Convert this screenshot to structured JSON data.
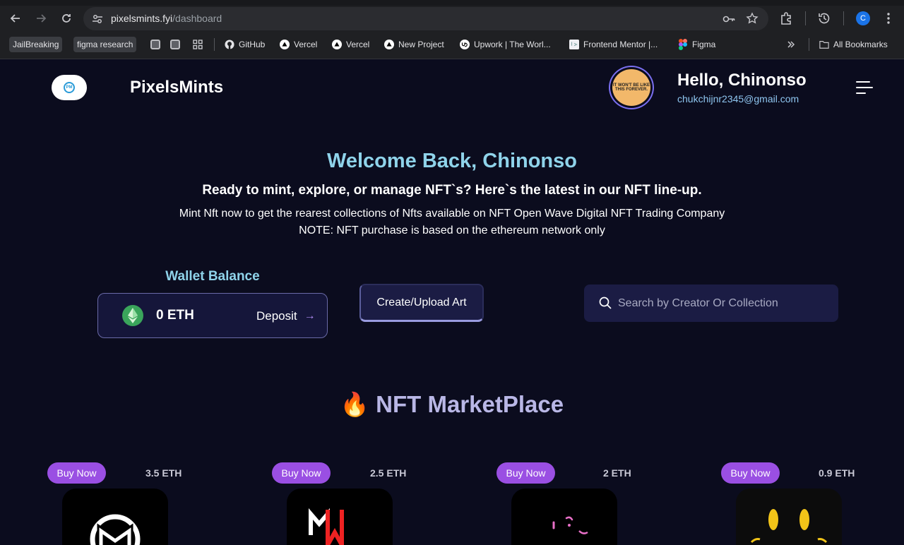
{
  "browser": {
    "url_domain": "pixelsmints.fyi",
    "url_path": "/dashboard",
    "profile_initial": "C",
    "bookmarks": [
      {
        "label": "JailBreaking",
        "kind": "chip"
      },
      {
        "label": "figma research",
        "kind": "chip"
      },
      {
        "label": "GitHub",
        "icon": "github-icon"
      },
      {
        "label": "Vercel",
        "icon": "vercel-icon"
      },
      {
        "label": "Vercel",
        "icon": "vercel-icon"
      },
      {
        "label": "New Project",
        "icon": "vercel-icon"
      },
      {
        "label": "Upwork | The Worl...",
        "icon": "upwork-icon"
      },
      {
        "label": "Frontend Mentor |...",
        "icon": "frontend-mentor-icon"
      },
      {
        "label": "Figma",
        "icon": "figma-icon"
      }
    ],
    "all_bookmarks": "All Bookmarks"
  },
  "header": {
    "brand": "PixelsMints",
    "greeting": "Hello, Chinonso",
    "email": "chukchijnr2345@gmail.com",
    "avatar_text": "IT WON'T BE LIKE THIS FOREVER."
  },
  "hero": {
    "welcome": "Welcome Back, Chinonso",
    "subtitle": "Ready to mint, explore, or manage NFT`s? Here`s the latest in our NFT line-up.",
    "line1": "Mint Nft now to get the rearest collections of Nfts available on NFT Open Wave Digital NFT Trading Company",
    "line2": "NOTE: NFT purchase is based on the ethereum network only"
  },
  "wallet": {
    "title": "Wallet Balance",
    "balance": "0 ETH",
    "deposit_label": "Deposit"
  },
  "actions": {
    "create_label": "Create/Upload Art",
    "search_placeholder": "Search by Creator Or Collection"
  },
  "market": {
    "title": "NFT MarketPlace",
    "items": [
      {
        "buy_label": "Buy Now",
        "price": "3.5 ETH"
      },
      {
        "buy_label": "Buy Now",
        "price": "2.5 ETH"
      },
      {
        "buy_label": "Buy Now",
        "price": "2 ETH"
      },
      {
        "buy_label": "Buy Now",
        "price": "0.9 ETH"
      }
    ]
  },
  "colors": {
    "page_bg": "#0b0c1e",
    "accent_cyan": "#8fd3ea",
    "buy_purple": "#9a4fe3",
    "card_bg": "#1b1c44"
  }
}
